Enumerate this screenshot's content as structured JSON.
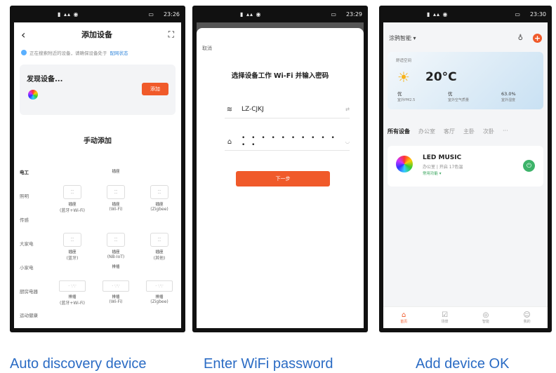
{
  "colors": {
    "accent": "#f05a2a",
    "caption": "#2a6bc4",
    "power_on": "#3db36a"
  },
  "captions": [
    "Auto discovery device",
    "Enter WiFi password",
    "Add device OK"
  ],
  "phone1": {
    "status_time": "23:26",
    "title": "添加设备",
    "hint_text": "正在搜索附近的设备，请确保设备处于",
    "hint_link": "配网状态",
    "found_title": "发现设备...",
    "add_label": "添加",
    "manual_title": "手动添加",
    "rows": [
      {
        "category": "电工",
        "bold": true,
        "cells": [
          {
            "type": "label",
            "text": "插座"
          }
        ]
      },
      {
        "category": "照明",
        "cells": [
          {
            "type": "socket",
            "name": "插座",
            "sub": "(蓝牙+Wi-Fi)"
          },
          {
            "type": "socket",
            "name": "插座",
            "sub": "(Wi-Fi)"
          },
          {
            "type": "socket",
            "name": "插座",
            "sub": "(Zigbee)"
          }
        ]
      },
      {
        "category": "传感",
        "cells": []
      },
      {
        "category": "大家电",
        "cells": [
          {
            "type": "socket",
            "name": "插座",
            "sub": "(蓝牙)"
          },
          {
            "type": "socket",
            "name": "插座",
            "sub": "(NB-IoT)"
          },
          {
            "type": "socket",
            "name": "插座",
            "sub": "(其他)"
          }
        ]
      },
      {
        "category": "小家电",
        "cells": [
          {
            "type": "label",
            "text": "排插"
          }
        ]
      },
      {
        "category": "厨房电器",
        "cells": [
          {
            "type": "strip",
            "name": "排插",
            "sub": "(蓝牙+Wi-Fi)"
          },
          {
            "type": "strip",
            "name": "排插",
            "sub": "(Wi-Fi)"
          },
          {
            "type": "strip",
            "name": "排插",
            "sub": "(Zigbee)"
          }
        ]
      },
      {
        "category": "运动健康",
        "cells": []
      }
    ]
  },
  "phone2": {
    "status_time": "23:29",
    "cancel": "取消",
    "title": "选择设备工作 Wi-Fi 并输入密码",
    "ssid": "LZ-CJKJ",
    "password_mask": "• • • • • • • • • • • •",
    "next": "下一步"
  },
  "phone3": {
    "status_time": "23:30",
    "home": "涂鸦智能 ▾",
    "weather_loc": "舒适空间",
    "temperature": "20°C",
    "metrics": [
      {
        "value": "优",
        "label": "室外PM2.5"
      },
      {
        "value": "优",
        "label": "室外空气质量"
      },
      {
        "value": "63.0%",
        "label": "室外湿度"
      }
    ],
    "tabs": [
      "所有设备",
      "办公室",
      "客厅",
      "主卧",
      "次卧",
      "···"
    ],
    "device": {
      "name": "LED MUSIC",
      "meta": "办公室 | 开启  17色温",
      "func": "常用功能 ▾"
    },
    "nav": [
      "首页",
      "场景",
      "智能",
      "我的"
    ]
  }
}
